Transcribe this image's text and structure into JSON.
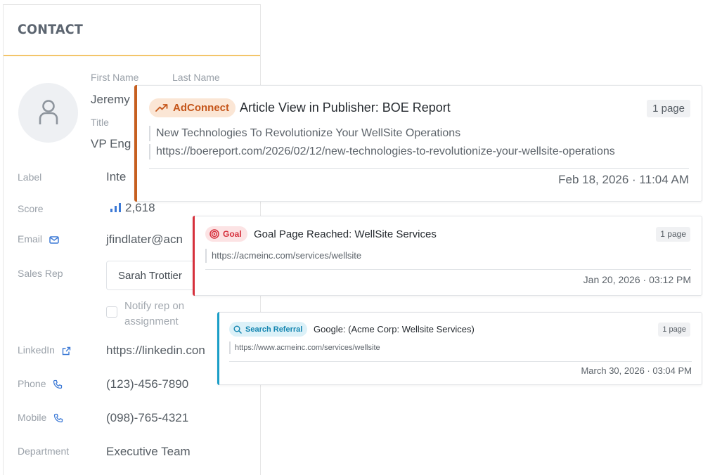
{
  "contact": {
    "title": "CONTACT",
    "first_name_label": "First Name",
    "last_name_label": "Last Name",
    "first_name_value": "Jeremy",
    "title_label": "Title",
    "title_value": "VP Eng",
    "fields": {
      "label": {
        "label": "Label",
        "value": "Inte"
      },
      "score": {
        "label": "Score",
        "value": "2,618"
      },
      "email": {
        "label": "Email",
        "value": "jfindlater@acn"
      },
      "sales_rep": {
        "label": "Sales Rep",
        "value": "Sarah Trottier"
      },
      "notify": {
        "label": "Notify rep on assignment",
        "checked": false
      },
      "linkedin": {
        "label": "LinkedIn",
        "value": "https://linkedin.con"
      },
      "phone": {
        "label": "Phone",
        "value": "(123)-456-7890"
      },
      "mobile": {
        "label": "Mobile",
        "value": "(098)-765-4321"
      },
      "department": {
        "label": "Department",
        "value": "Executive Team"
      }
    }
  },
  "activities": [
    {
      "badge": "AdConnect",
      "badge_icon": "trending-up-icon",
      "title": "Article View in Publisher: BOE Report",
      "pages": "1 page",
      "lines": [
        "New Technologies To Revolutionize Your WellSite Operations",
        "https://boereport.com/2026/02/12/new-technologies-to-revolutionize-your-wellsite-operations"
      ],
      "timestamp": "Feb 18, 2026 · 11:04 AM",
      "accent": "#c65f1f"
    },
    {
      "badge": "Goal",
      "badge_icon": "target-icon",
      "title": "Goal Page Reached: WellSite Services",
      "pages": "1 page",
      "lines": [
        "https://acmeinc.com/services/wellsite"
      ],
      "timestamp": "Jan 20, 2026 · 03:12 PM",
      "accent": "#d6303c"
    },
    {
      "badge": "Search Referral",
      "badge_icon": "search-icon",
      "title": "Google: (Acme Corp: Wellsite Services)",
      "pages": "1 page",
      "lines": [
        "https://www.acmeinc.com/services/wellsite"
      ],
      "timestamp": "March 30, 2026 · 03:04 PM",
      "accent": "#1a9ec7"
    }
  ]
}
